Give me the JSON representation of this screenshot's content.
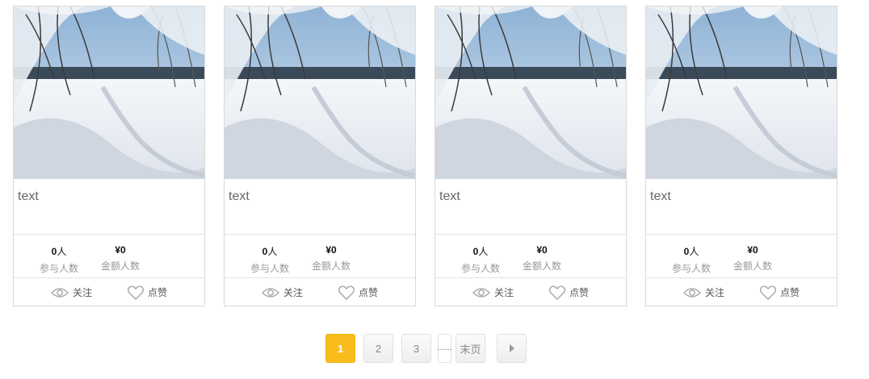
{
  "cards": [
    {
      "title": "text",
      "people_value": "0",
      "people_unit": "人",
      "people_label": "参与人数",
      "amount_value": "¥0",
      "amount_label": "金额人数",
      "follow_label": "关注",
      "like_label": "点赞"
    },
    {
      "title": "text",
      "people_value": "0",
      "people_unit": "人",
      "people_label": "参与人数",
      "amount_value": "¥0",
      "amount_label": "金额人数",
      "follow_label": "关注",
      "like_label": "点赞"
    },
    {
      "title": "text",
      "people_value": "0",
      "people_unit": "人",
      "people_label": "参与人数",
      "amount_value": "¥0",
      "amount_label": "金额人数",
      "follow_label": "关注",
      "like_label": "点赞"
    },
    {
      "title": "text",
      "people_value": "0",
      "people_unit": "人",
      "people_label": "参与人数",
      "amount_value": "¥0",
      "amount_label": "金额人数",
      "follow_label": "关注",
      "like_label": "点赞"
    }
  ],
  "pagination": {
    "pages": [
      "1",
      "2",
      "3"
    ],
    "current": "1",
    "ellipsis": "......",
    "last_label": "末页",
    "next_icon": "caret-right-icon"
  },
  "colors": {
    "accent": "#f8bd1d",
    "border": "#d9d9d9",
    "muted_text": "#999999"
  },
  "icons": {
    "follow": "eye-icon",
    "like": "heart-icon",
    "image": "snowy-forest-photo"
  }
}
